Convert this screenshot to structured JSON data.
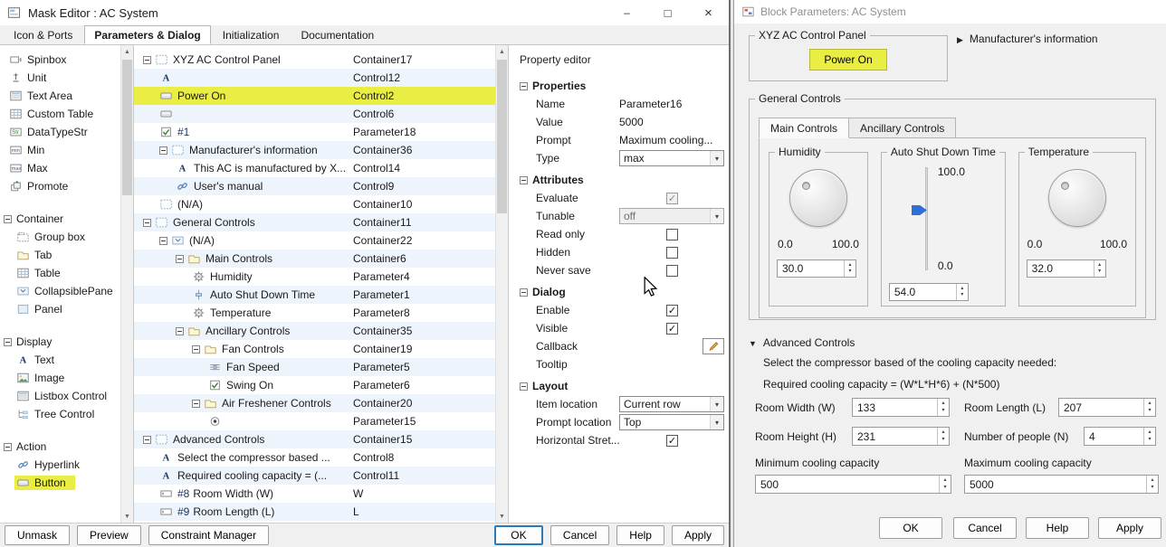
{
  "colors": {
    "highlight": "#e9ed44",
    "slider_accent": "#2f6fd6",
    "focus_border": "#2a7ab9"
  },
  "mask_editor": {
    "title": "Mask Editor : AC System",
    "tabs": [
      "Icon & Ports",
      "Parameters & Dialog",
      "Initialization",
      "Documentation"
    ],
    "active_tab": "Parameters & Dialog",
    "palette": {
      "top_items": [
        {
          "label": "Spinbox"
        },
        {
          "label": "Unit"
        },
        {
          "label": "Text Area"
        },
        {
          "label": "Custom Table"
        },
        {
          "label": "DataTypeStr"
        },
        {
          "label": "Min"
        },
        {
          "label": "Max"
        },
        {
          "label": "Promote"
        }
      ],
      "sections": [
        {
          "header": "Container",
          "items": [
            {
              "label": "Group box"
            },
            {
              "label": "Tab"
            },
            {
              "label": "Table"
            },
            {
              "label": "CollapsiblePane"
            },
            {
              "label": "Panel"
            }
          ]
        },
        {
          "header": "Display",
          "items": [
            {
              "label": "Text"
            },
            {
              "label": "Image"
            },
            {
              "label": "Listbox Control"
            },
            {
              "label": "Tree Control"
            }
          ]
        },
        {
          "header": "Action",
          "items": [
            {
              "label": "Hyperlink"
            },
            {
              "label": "Button"
            }
          ]
        }
      ]
    },
    "tree": {
      "rows": [
        {
          "label": "XYZ AC Control Panel",
          "name": "Container17"
        },
        {
          "label": "",
          "name": "Control12"
        },
        {
          "label": "Power On",
          "name": "Control2"
        },
        {
          "label": "",
          "name": "Control6"
        },
        {
          "badge": "#1",
          "label": "",
          "name": "Parameter18"
        },
        {
          "label": "Manufacturer's information",
          "name": "Container36"
        },
        {
          "label": "This AC is manufactured by X...",
          "name": "Control14"
        },
        {
          "label": "User's manual",
          "name": "Control9"
        },
        {
          "label": "(N/A)",
          "name": "Container10"
        },
        {
          "label": "General Controls",
          "name": "Container11"
        },
        {
          "label": "(N/A)",
          "name": "Container22"
        },
        {
          "label": "Main Controls",
          "name": "Container6"
        },
        {
          "label": "Humidity",
          "name": "Parameter4"
        },
        {
          "label": "Auto Shut Down Time",
          "name": "Parameter1"
        },
        {
          "label": "Temperature",
          "name": "Parameter8"
        },
        {
          "label": "Ancillary Controls",
          "name": "Container35"
        },
        {
          "label": "Fan Controls",
          "name": "Container19"
        },
        {
          "label": "Fan Speed",
          "name": "Parameter5"
        },
        {
          "label": "Swing On",
          "name": "Parameter6"
        },
        {
          "label": "Air Freshener Controls",
          "name": "Container20"
        },
        {
          "label": "",
          "name": "Parameter15"
        },
        {
          "label": "Advanced Controls",
          "name": "Container15"
        },
        {
          "label": "Select the compressor based ...",
          "name": "Control8"
        },
        {
          "label": "Required cooling capacity = (...",
          "name": "Control11"
        },
        {
          "badge": "#8",
          "label": "Room Width (W)",
          "name": "W"
        },
        {
          "badge": "#9",
          "label": "Room Length (L)",
          "name": "L"
        }
      ]
    },
    "property_editor": {
      "title": "Property editor",
      "properties": {
        "header": "Properties",
        "name_label": "Name",
        "name_value": "Parameter16",
        "value_label": "Value",
        "value_value": "5000",
        "prompt_label": "Prompt",
        "prompt_value": "Maximum cooling...",
        "type_label": "Type",
        "type_value": "max"
      },
      "attributes": {
        "header": "Attributes",
        "evaluate_label": "Evaluate",
        "tunable_label": "Tunable",
        "tunable_value": "off",
        "readonly_label": "Read only",
        "hidden_label": "Hidden",
        "neversave_label": "Never save"
      },
      "dialog": {
        "header": "Dialog",
        "enable_label": "Enable",
        "visible_label": "Visible",
        "callback_label": "Callback",
        "tooltip_label": "Tooltip"
      },
      "layout": {
        "header": "Layout",
        "item_location_label": "Item location",
        "item_location_value": "Current row",
        "prompt_location_label": "Prompt location",
        "prompt_location_value": "Top",
        "hstretch_label": "Horizontal Stret..."
      }
    },
    "footer": {
      "unmask": "Unmask",
      "preview": "Preview",
      "constraint_manager": "Constraint Manager",
      "ok": "OK",
      "cancel": "Cancel",
      "help": "Help",
      "apply": "Apply"
    }
  },
  "block_params": {
    "title": "Block Parameters: AC System",
    "xyz_panel": {
      "title": "XYZ AC Control Panel",
      "power_on": "Power On"
    },
    "manufacturer_section": "Manufacturer's information",
    "general": {
      "title": "General Controls",
      "tabs": [
        "Main Controls",
        "Ancillary Controls"
      ],
      "active_tab": "Main Controls",
      "humidity": {
        "title": "Humidity",
        "min": "0.0",
        "max": "100.0",
        "value": "30.0"
      },
      "shutdown": {
        "title": "Auto Shut Down Time",
        "top": "100.0",
        "bottom": "0.0",
        "value": "54.0"
      },
      "temperature": {
        "title": "Temperature",
        "min": "0.0",
        "max": "100.0",
        "value": "32.0"
      }
    },
    "advanced": {
      "title": "Advanced Controls",
      "line1": "Select the compressor based of the cooling capacity needed:",
      "line2": "Required cooling capacity = (W*L*H*6) + (N*500)",
      "room_width_label": "Room Width (W)",
      "room_width_value": "133",
      "room_length_label": "Room Length (L)",
      "room_length_value": "207",
      "room_height_label": "Room Height (H)",
      "room_height_value": "231",
      "people_label": "Number of people (N)",
      "people_value": "4",
      "min_capacity_label": "Minimum cooling capacity",
      "min_capacity_value": "500",
      "max_capacity_label": "Maximum cooling capacity",
      "max_capacity_value": "5000"
    },
    "footer": {
      "ok": "OK",
      "cancel": "Cancel",
      "help": "Help",
      "apply": "Apply"
    }
  }
}
